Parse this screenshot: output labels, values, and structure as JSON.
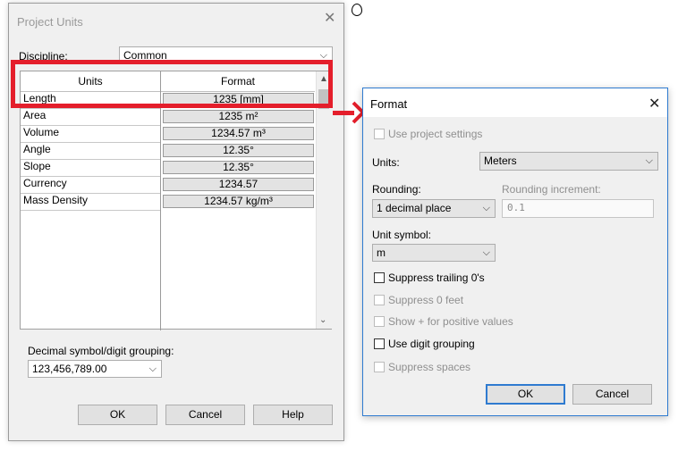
{
  "cursor_glyph": "○",
  "project_units": {
    "title": "Project Units",
    "close_glyph": "✕",
    "discipline_label": "Discipline:",
    "discipline_value": "Common",
    "columns": {
      "units": "Units",
      "format": "Format"
    },
    "rows": [
      {
        "unit": "Length",
        "format": "1235 [mm]"
      },
      {
        "unit": "Area",
        "format": "1235 m²"
      },
      {
        "unit": "Volume",
        "format": "1234.57 m³"
      },
      {
        "unit": "Angle",
        "format": "12.35°"
      },
      {
        "unit": "Slope",
        "format": "12.35°"
      },
      {
        "unit": "Currency",
        "format": "1234.57"
      },
      {
        "unit": "Mass Density",
        "format": "1234.57 kg/m³"
      }
    ],
    "decimal_label": "Decimal symbol/digit grouping:",
    "decimal_value": "123,456,789.00",
    "ok": "OK",
    "cancel": "Cancel",
    "help": "Help"
  },
  "format_dialog": {
    "title": "Format",
    "close_glyph": "✕",
    "use_project_settings": "Use project settings",
    "units_label": "Units:",
    "units_value": "Meters",
    "rounding_label": "Rounding:",
    "rounding_value": "1 decimal place",
    "rounding_increment_label": "Rounding increment:",
    "rounding_increment_value": "0.1",
    "unit_symbol_label": "Unit symbol:",
    "unit_symbol_value": "m",
    "suppress_trailing": "Suppress trailing 0's",
    "suppress_zero_feet": "Suppress 0 feet",
    "show_plus": "Show + for positive values",
    "use_digit_grouping": "Use digit grouping",
    "suppress_spaces": "Suppress spaces",
    "ok": "OK",
    "cancel": "Cancel"
  },
  "colors": {
    "highlight": "#e41e2b",
    "accent": "#2f7bd0"
  }
}
